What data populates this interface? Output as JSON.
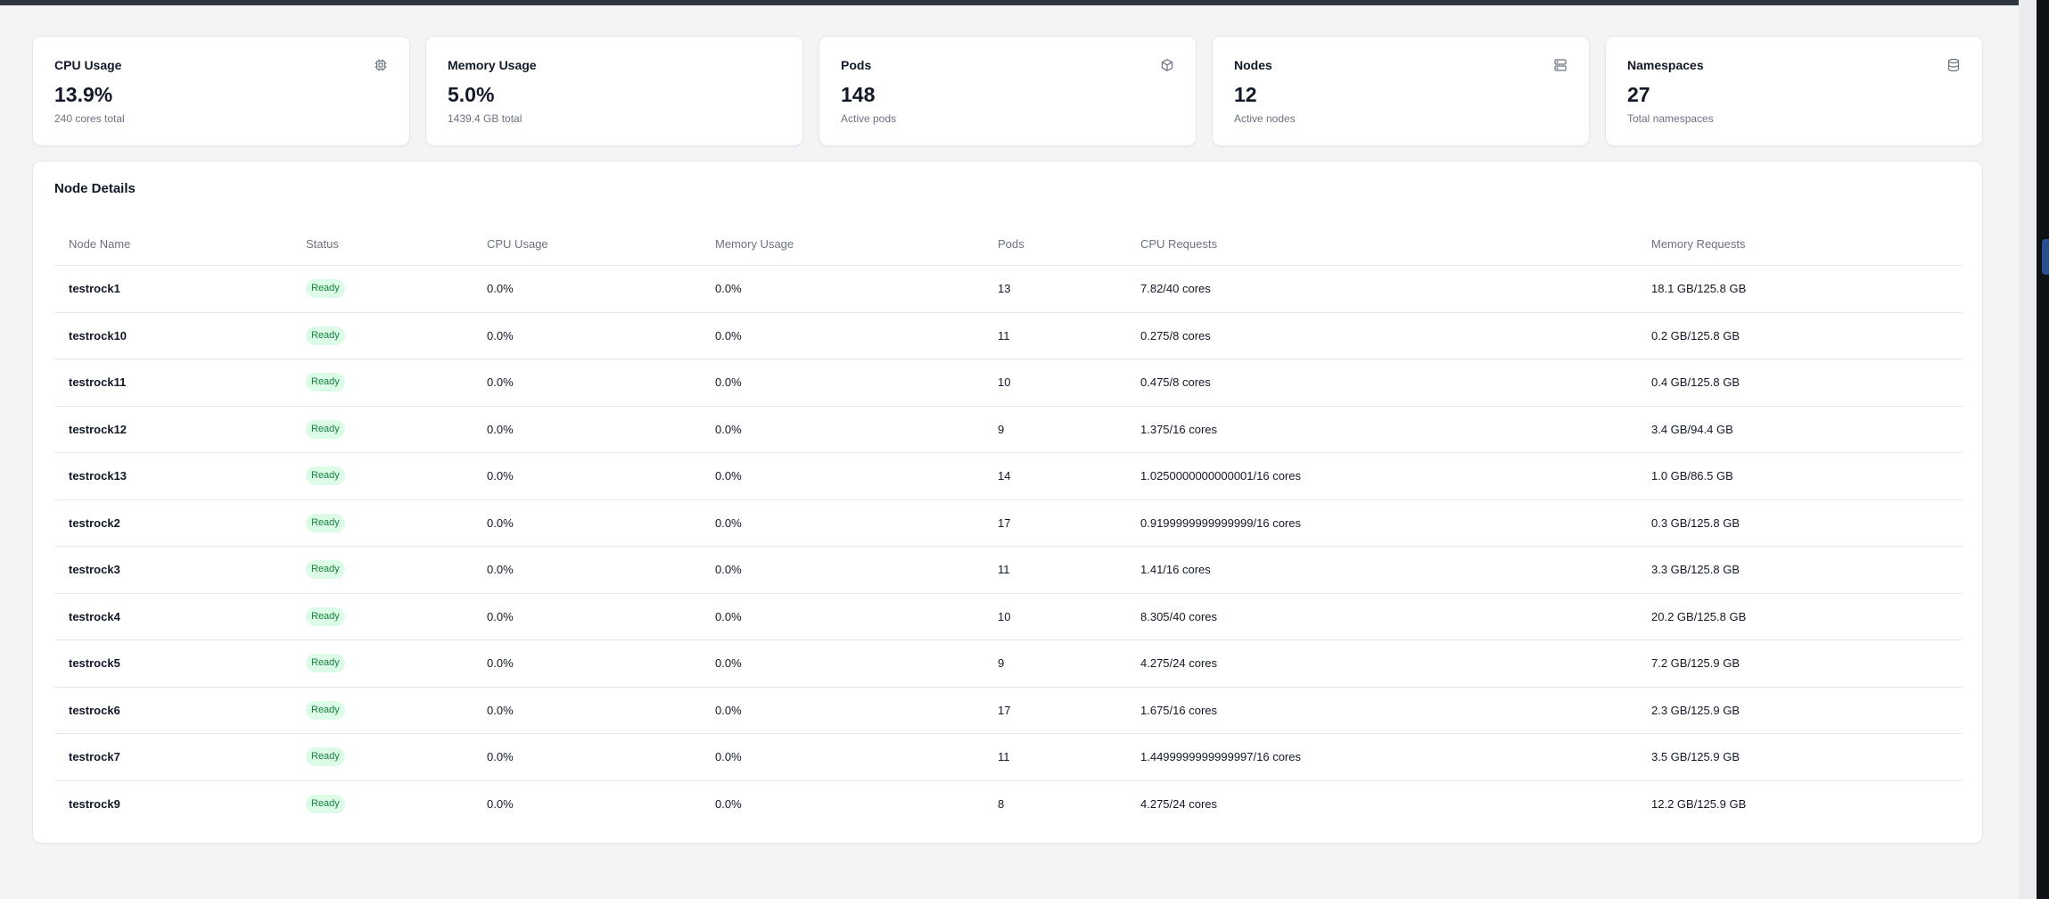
{
  "colors": {
    "accent_ready_text": "#15803d",
    "accent_ready_bg": "#dcfce7",
    "topbar": "#2f3541"
  },
  "cards": [
    {
      "title": "CPU Usage",
      "value": "13.9%",
      "subtitle": "240 cores total",
      "icon": "cpu-icon"
    },
    {
      "title": "Memory Usage",
      "value": "5.0%",
      "subtitle": "1439.4 GB total",
      "icon": ""
    },
    {
      "title": "Pods",
      "value": "148",
      "subtitle": "Active pods",
      "icon": "cube-icon"
    },
    {
      "title": "Nodes",
      "value": "12",
      "subtitle": "Active nodes",
      "icon": "server-icon"
    },
    {
      "title": "Namespaces",
      "value": "27",
      "subtitle": "Total namespaces",
      "icon": "database-icon"
    }
  ],
  "node_details": {
    "title": "Node Details",
    "columns": [
      "Node Name",
      "Status",
      "CPU Usage",
      "Memory Usage",
      "Pods",
      "CPU Requests",
      "Memory Requests"
    ],
    "rows": [
      [
        "testrock1",
        "Ready",
        "0.0%",
        "0.0%",
        "13",
        "7.82/40 cores",
        "18.1 GB/125.8 GB"
      ],
      [
        "testrock10",
        "Ready",
        "0.0%",
        "0.0%",
        "11",
        "0.275/8 cores",
        "0.2 GB/125.8 GB"
      ],
      [
        "testrock11",
        "Ready",
        "0.0%",
        "0.0%",
        "10",
        "0.475/8 cores",
        "0.4 GB/125.8 GB"
      ],
      [
        "testrock12",
        "Ready",
        "0.0%",
        "0.0%",
        "9",
        "1.375/16 cores",
        "3.4 GB/94.4 GB"
      ],
      [
        "testrock13",
        "Ready",
        "0.0%",
        "0.0%",
        "14",
        "1.0250000000000001/16 cores",
        "1.0 GB/86.5 GB"
      ],
      [
        "testrock2",
        "Ready",
        "0.0%",
        "0.0%",
        "17",
        "0.9199999999999999/16 cores",
        "0.3 GB/125.8 GB"
      ],
      [
        "testrock3",
        "Ready",
        "0.0%",
        "0.0%",
        "11",
        "1.41/16 cores",
        "3.3 GB/125.8 GB"
      ],
      [
        "testrock4",
        "Ready",
        "0.0%",
        "0.0%",
        "10",
        "8.305/40 cores",
        "20.2 GB/125.8 GB"
      ],
      [
        "testrock5",
        "Ready",
        "0.0%",
        "0.0%",
        "9",
        "4.275/24 cores",
        "7.2 GB/125.9 GB"
      ],
      [
        "testrock6",
        "Ready",
        "0.0%",
        "0.0%",
        "17",
        "1.675/16 cores",
        "2.3 GB/125.9 GB"
      ],
      [
        "testrock7",
        "Ready",
        "0.0%",
        "0.0%",
        "11",
        "1.4499999999999997/16 cores",
        "3.5 GB/125.9 GB"
      ],
      [
        "testrock9",
        "Ready",
        "0.0%",
        "0.0%",
        "8",
        "4.275/24 cores",
        "12.2 GB/125.9 GB"
      ]
    ]
  }
}
